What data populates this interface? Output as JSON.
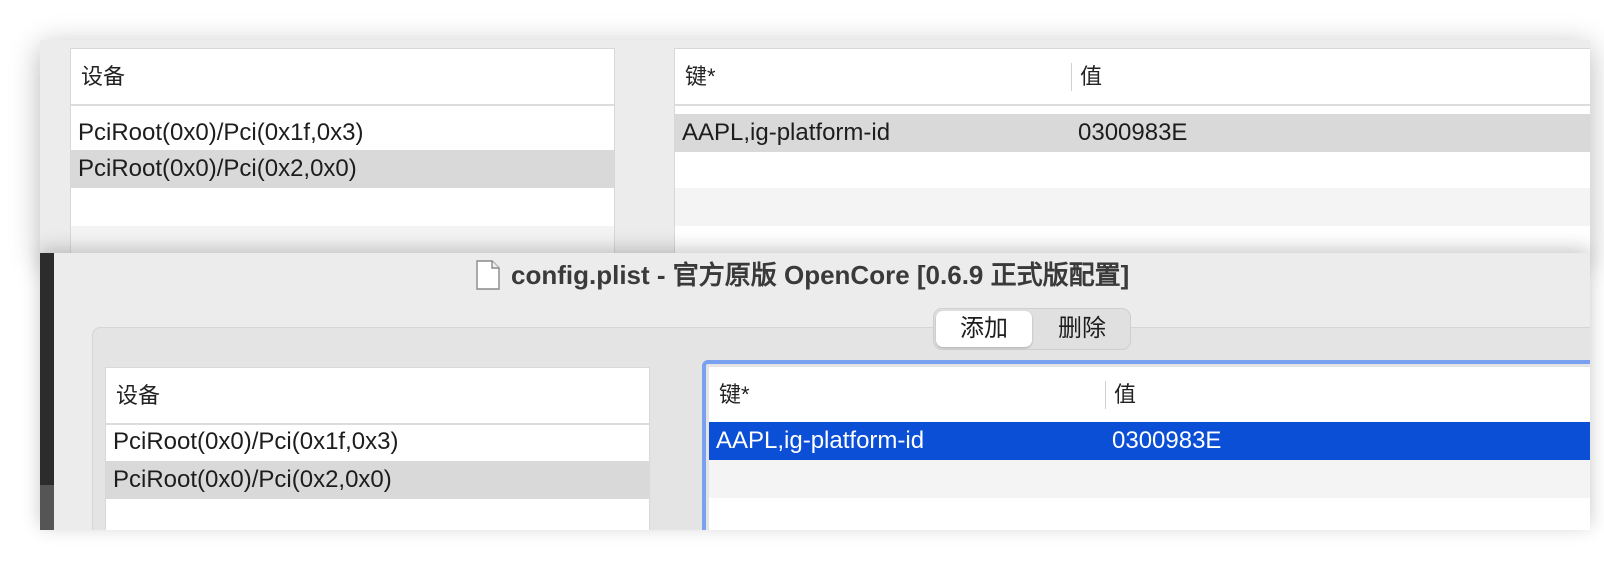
{
  "back_window": {
    "devices_table": {
      "header": "设备",
      "rows": [
        "PciRoot(0x0)/Pci(0x1f,0x3)",
        "PciRoot(0x0)/Pci(0x2,0x0)"
      ]
    },
    "props_table": {
      "key_header": "键*",
      "value_header": "值",
      "rows": [
        {
          "key": "AAPL,ig-platform-id",
          "value": "0300983E"
        }
      ]
    }
  },
  "front_window": {
    "title": "config.plist - 官方原版 OpenCore [0.6.9 正式版配置]",
    "title_icon": "document-icon",
    "segmented": {
      "add_label": "添加",
      "delete_label": "删除",
      "selected": "添加"
    },
    "devices_table": {
      "header": "设备",
      "rows": [
        "PciRoot(0x0)/Pci(0x1f,0x3)",
        "PciRoot(0x0)/Pci(0x2,0x0)"
      ]
    },
    "props_table": {
      "key_header": "键*",
      "value_header": "值",
      "rows": [
        {
          "key": "AAPL,ig-platform-id",
          "value": "0300983E"
        }
      ]
    }
  },
  "colors": {
    "selection_blue": "#0b4fd6",
    "focus_ring": "#7aa1f0",
    "selection_gray": "#d9d9d9"
  }
}
